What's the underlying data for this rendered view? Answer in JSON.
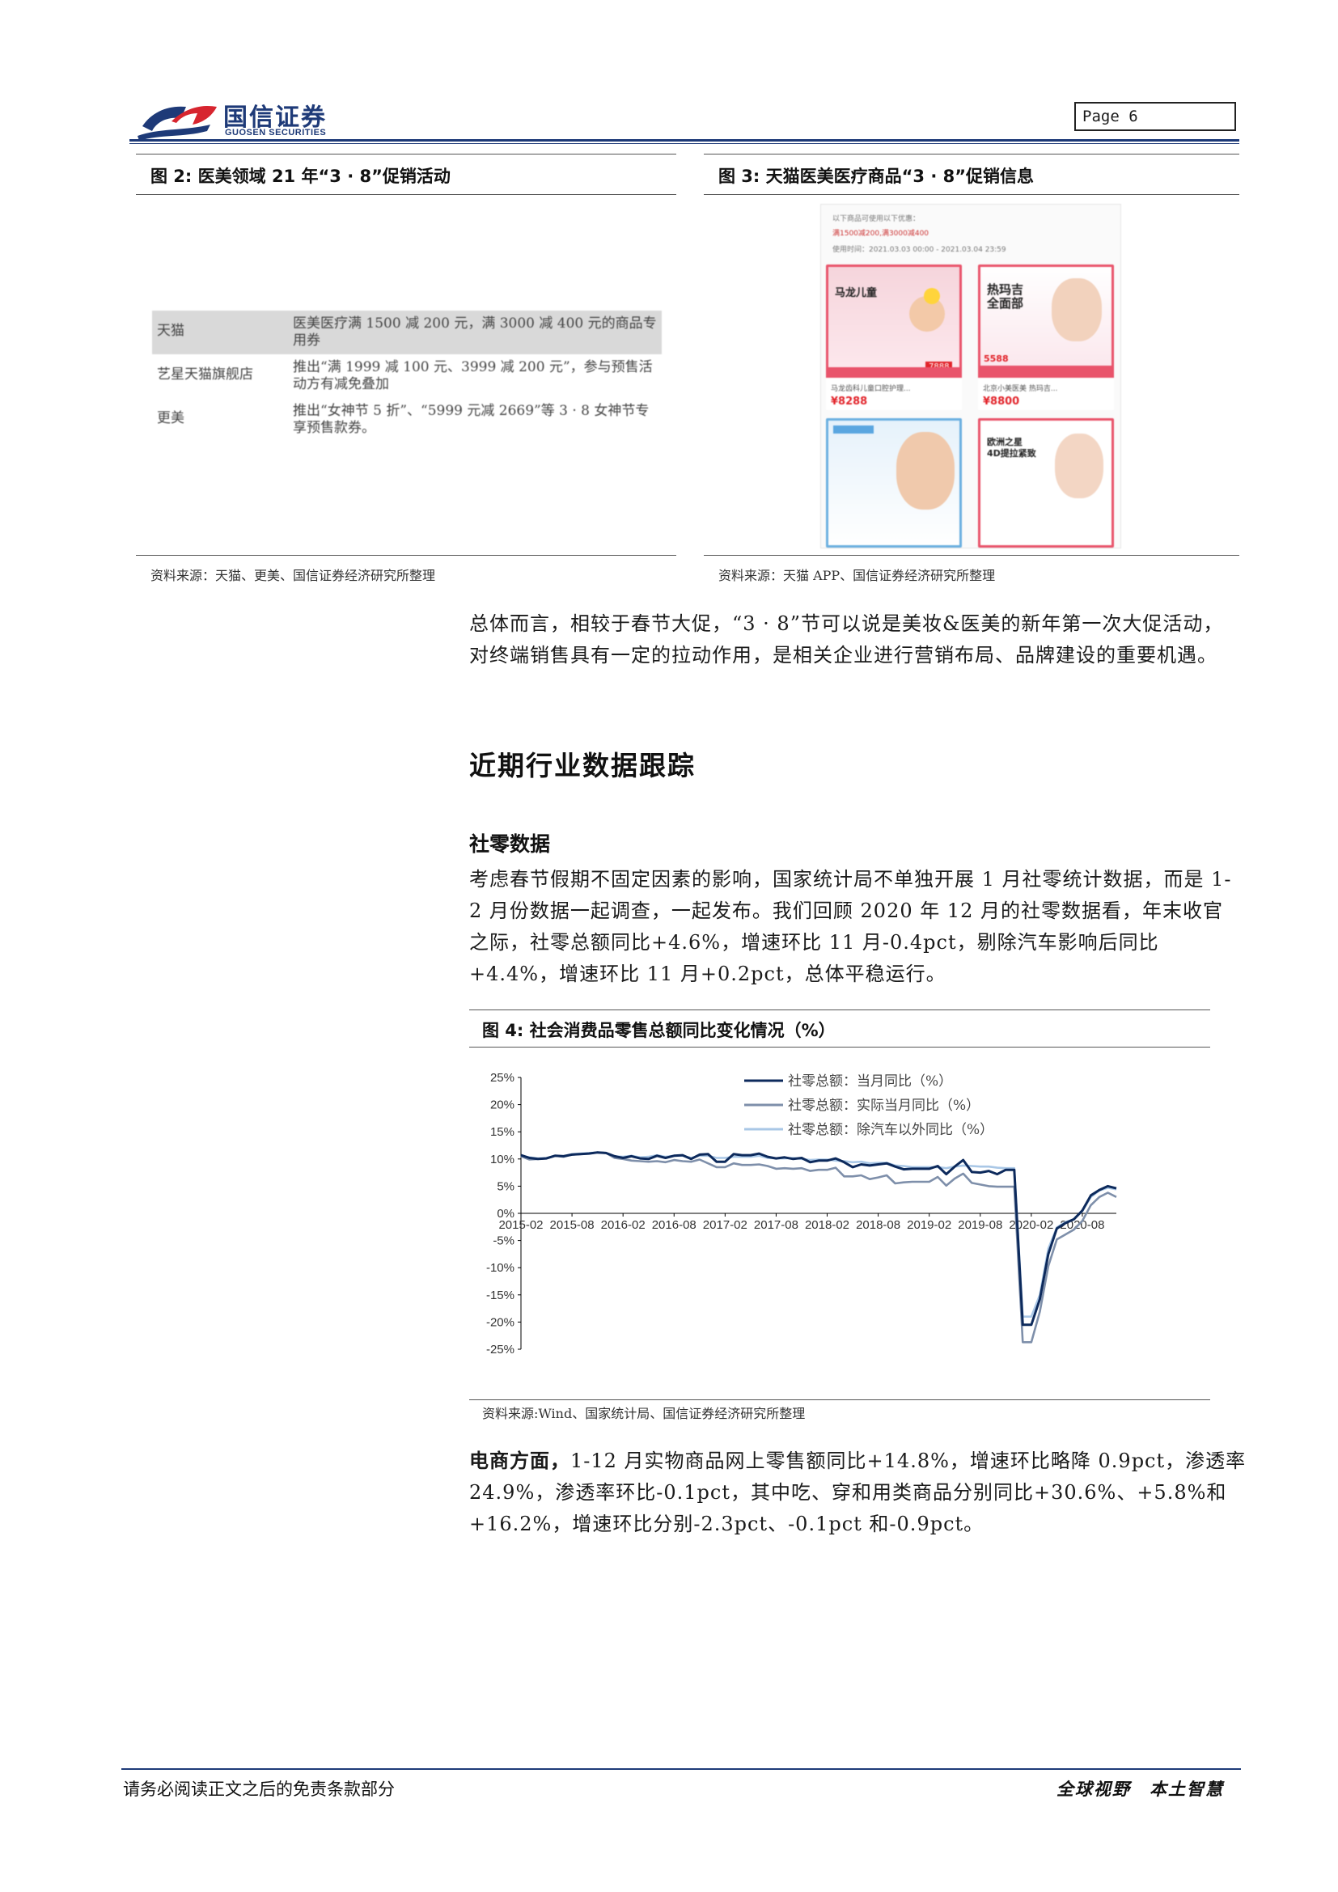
{
  "header": {
    "logo_cn": "国信证券",
    "logo_en": "GUOSEN SECURITIES",
    "page_label": "Page  6"
  },
  "fig2": {
    "caption": "图 2:  医美领域 21 年“3 · 8”促销活动",
    "rows": [
      {
        "platform": "天猫",
        "desc": "医美医疗满 1500 减 200 元，满 3000 减 400 元的商品专用券"
      },
      {
        "platform": "艺星天猫旗舰店",
        "desc": "推出“满 1999 减 100 元、3999 减 200 元”，参与预售活动方有减免叠加"
      },
      {
        "platform": "更美",
        "desc": "推出“女神节 5 折”、“5999 元减 2669”等 3 · 8 女神节专享预售款券。"
      }
    ],
    "source": "资料来源：天猫、更美、国信证券经济研究所整理"
  },
  "fig3": {
    "caption": "图 3:  天猫医美医疗商品“3 · 8”促销信息",
    "source": "资料来源：天猫 APP、国信证券经济研究所整理",
    "screen": {
      "line1": "以下商品可使用以下优惠：",
      "line2": "满1500减200,满3000减400",
      "line3": "使用时间：2021.03.03 00:00 - 2021.03.04 23:59",
      "cards": [
        {
          "title": "马龙儿童",
          "price": "¥8288",
          "desc": "马龙齿科儿童口腔护理..."
        },
        {
          "title": "热玛吉\n全面部",
          "price": "¥8800",
          "desc": "北京小美医美 热玛吉..."
        },
        {
          "title": "",
          "price": "",
          "desc": ""
        },
        {
          "title": "欧洲之星\n4D提拉紧致",
          "price": "",
          "desc": ""
        }
      ],
      "tags": [
        "7888",
        "5588"
      ]
    }
  },
  "body": {
    "p1": "总体而言，相较于春节大促，“3 · 8”节可以说是美妆&医美的新年第一次大促活动，对终端销售具有一定的拉动作用，是相关企业进行营销布局、品牌建设的重要机遇。",
    "section_title": "近期行业数据跟踪",
    "subsection_title": "社零数据",
    "p2": "考虑春节假期不固定因素的影响，国家统计局不单独开展 1 月社零统计数据，而是 1-2 月份数据一起调查，一起发布。我们回顾 2020 年 12 月的社零数据看，年末收官之际，社零总额同比+4.6%，增速环比 11 月-0.4pct，剔除汽车影响后同比+4.4%，增速环比 11 月+0.2pct，总体平稳运行。",
    "p3_lead": "电商方面，",
    "p3_rest": "1-12 月实物商品网上零售额同比+14.8%，增速环比略降 0.9pct，渗透率 24.9%，渗透率环比-0.1pct，其中吃、穿和用类商品分别同比+30.6%、+5.8%和+16.2%，增速环比分别-2.3pct、-0.1pct 和-0.9pct。"
  },
  "fig4": {
    "caption": "图 4:  社会消费品零售总额同比变化情况（%）",
    "source": "资料来源:Wind、国家统计局、国信证券经济研究所整理"
  },
  "chart_data": {
    "type": "line",
    "ylim": [
      -25,
      25
    ],
    "yticks": [
      "25%",
      "20%",
      "15%",
      "10%",
      "5%",
      "0%",
      "-5%",
      "-10%",
      "-15%",
      "-20%",
      "-25%"
    ],
    "xticks": [
      "2015-02",
      "2015-08",
      "2016-02",
      "2016-08",
      "2017-02",
      "2017-08",
      "2018-02",
      "2018-08",
      "2019-02",
      "2019-08",
      "2020-02",
      "2020-08"
    ],
    "legend_position": "top",
    "x": [
      "2015-02",
      "2015-03",
      "2015-04",
      "2015-05",
      "2015-06",
      "2015-07",
      "2015-08",
      "2015-09",
      "2015-10",
      "2015-11",
      "2015-12",
      "2016-01",
      "2016-02",
      "2016-03",
      "2016-04",
      "2016-05",
      "2016-06",
      "2016-07",
      "2016-08",
      "2016-09",
      "2016-10",
      "2016-11",
      "2016-12",
      "2017-01",
      "2017-02",
      "2017-03",
      "2017-04",
      "2017-05",
      "2017-06",
      "2017-07",
      "2017-08",
      "2017-09",
      "2017-10",
      "2017-11",
      "2017-12",
      "2018-01",
      "2018-02",
      "2018-03",
      "2018-04",
      "2018-05",
      "2018-06",
      "2018-07",
      "2018-08",
      "2018-09",
      "2018-10",
      "2018-11",
      "2018-12",
      "2019-01",
      "2019-02",
      "2019-03",
      "2019-04",
      "2019-05",
      "2019-06",
      "2019-07",
      "2019-08",
      "2019-09",
      "2019-10",
      "2019-11",
      "2019-12",
      "2020-01",
      "2020-02",
      "2020-03",
      "2020-04",
      "2020-05",
      "2020-06",
      "2020-07",
      "2020-08",
      "2020-09",
      "2020-10",
      "2020-11",
      "2020-12"
    ],
    "series": [
      {
        "name": "社零总额：当月同比（%）",
        "color": "#0d2a5c",
        "values": [
          10.7,
          10.2,
          10.0,
          10.1,
          10.6,
          10.5,
          10.8,
          10.9,
          11.0,
          11.2,
          11.1,
          10.5,
          10.2,
          10.5,
          10.1,
          10.0,
          10.6,
          10.2,
          10.6,
          10.7,
          10.0,
          10.8,
          10.9,
          9.5,
          9.5,
          10.9,
          10.7,
          10.7,
          11.0,
          10.4,
          10.1,
          10.3,
          10.0,
          10.2,
          9.4,
          9.7,
          9.7,
          10.1,
          9.4,
          8.5,
          9.0,
          8.8,
          9.0,
          9.2,
          8.6,
          8.1,
          8.2,
          8.2,
          8.2,
          8.7,
          7.2,
          8.6,
          9.8,
          7.6,
          7.5,
          7.8,
          7.2,
          8.0,
          8.0,
          -20.5,
          -20.5,
          -15.8,
          -7.5,
          -2.8,
          -1.8,
          -1.1,
          0.5,
          3.3,
          4.3,
          5.0,
          4.6
        ]
      },
      {
        "name": "社零总额：实际当月同比（%）",
        "color": "#7e8faa",
        "values": [
          10.5,
          9.9,
          10.0,
          10.1,
          10.6,
          10.4,
          10.8,
          10.9,
          11.0,
          11.2,
          11.1,
          10.2,
          10.0,
          9.7,
          9.6,
          9.5,
          9.6,
          9.4,
          9.8,
          9.6,
          9.5,
          9.9,
          9.2,
          8.5,
          8.5,
          9.2,
          8.9,
          8.9,
          9.0,
          8.7,
          8.2,
          8.3,
          8.2,
          8.3,
          7.8,
          8.0,
          8.0,
          8.4,
          6.8,
          6.8,
          7.0,
          6.3,
          6.6,
          7.0,
          5.5,
          5.7,
          5.8,
          5.8,
          5.8,
          6.7,
          5.1,
          6.4,
          7.3,
          5.6,
          5.3,
          5.0,
          4.9,
          4.9,
          4.9,
          -23.7,
          -23.7,
          -18.1,
          -9.7,
          -4.8,
          -3.9,
          -3.0,
          -1.4,
          1.5,
          3.0,
          3.8,
          3.0
        ]
      },
      {
        "name": "社零总额：除汽车以外同比（%）",
        "color": "#a9c7e6",
        "values": [
          10.6,
          10.3,
          10.1,
          10.2,
          10.6,
          10.5,
          10.9,
          11.0,
          11.1,
          11.2,
          11.1,
          10.5,
          10.4,
          10.6,
          10.3,
          10.4,
          10.7,
          10.4,
          10.6,
          10.6,
          10.2,
          10.6,
          10.6,
          10.2,
          10.2,
          10.4,
          10.4,
          10.4,
          10.6,
          10.2,
          10.1,
          10.1,
          10.2,
          10.0,
          9.8,
          9.9,
          9.9,
          9.7,
          9.6,
          9.4,
          9.5,
          9.2,
          9.3,
          9.3,
          8.8,
          8.7,
          8.5,
          8.5,
          8.5,
          8.5,
          8.3,
          8.6,
          8.8,
          8.7,
          8.6,
          8.6,
          8.4,
          8.3,
          8.3,
          -19.0,
          -19.0,
          -15.0,
          -6.5,
          -2.6,
          -1.6,
          -1.1,
          0.4,
          3.0,
          4.2,
          4.7,
          4.4
        ]
      }
    ]
  }
}
